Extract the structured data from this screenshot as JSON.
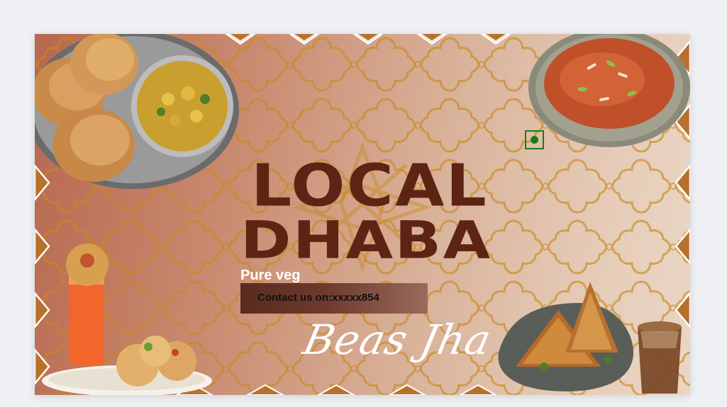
{
  "poster": {
    "title_line1": "LOCAL",
    "title_line2": "DHABA",
    "tagline": "Pure veg",
    "contact": "Contact us on:xxxxx854",
    "contact_mark": "`",
    "signature": "Beas Jha"
  },
  "colors": {
    "title": "#5e2413",
    "pattern": "#c8891f",
    "background_start": "#b7684f",
    "background_end": "#ead6c5",
    "veg_mark": "#1e7a1e"
  },
  "icons": {
    "veg_symbol": "veg-mark-icon",
    "dishes": [
      "puri-bhaji-icon",
      "gajar-halwa-icon",
      "pani-puri-icon",
      "samosa-icon",
      "chai-icon"
    ]
  }
}
